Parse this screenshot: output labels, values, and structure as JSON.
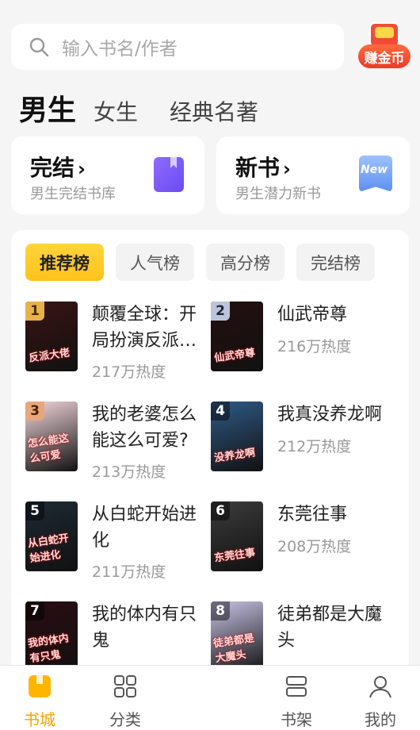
{
  "search": {
    "placeholder": "输入书名/作者"
  },
  "earn_coins": {
    "label": "赚金币"
  },
  "gender_tabs": [
    {
      "label": "男生",
      "active": true
    },
    {
      "label": "女生",
      "active": false
    },
    {
      "label": "经典名著",
      "active": false
    }
  ],
  "cards": [
    {
      "title": "完结",
      "subtitle": "男生完结书库",
      "icon": "book-icon"
    },
    {
      "title": "新书",
      "subtitle": "男生潜力新书",
      "icon": "new-badge-icon",
      "badge": "New"
    }
  ],
  "ranking_tabs": [
    {
      "label": "推荐榜",
      "active": true
    },
    {
      "label": "人气榜",
      "active": false
    },
    {
      "label": "高分榜",
      "active": false
    },
    {
      "label": "完结榜",
      "active": false
    }
  ],
  "books": [
    {
      "rank": "1",
      "title": "颠覆全球：开局扮演反派…",
      "heat": "217万热度",
      "cover_text": "反派大佬",
      "cover_color": "#3a1414"
    },
    {
      "rank": "2",
      "title": "仙武帝尊",
      "heat": "216万热度",
      "cover_text": "仙武帝尊",
      "cover_color": "#241010"
    },
    {
      "rank": "3",
      "title": "我的老婆怎么能这么可爱?",
      "heat": "213万热度",
      "cover_text": "怎么能这么可爱",
      "cover_color": "#f3d7dc"
    },
    {
      "rank": "4",
      "title": "我真没养龙啊",
      "heat": "212万热度",
      "cover_text": "没养龙啊",
      "cover_color": "#2f5a86"
    },
    {
      "rank": "5",
      "title": "从白蛇开始进化",
      "heat": "211万热度",
      "cover_text": "从白蛇开始进化",
      "cover_color": "#1d2a33"
    },
    {
      "rank": "6",
      "title": "东莞往事",
      "heat": "208万热度",
      "cover_text": "东莞往事",
      "cover_color": "#3c3c3c"
    },
    {
      "rank": "7",
      "title": "我的体内有只鬼",
      "heat": "",
      "cover_text": "我的体内有只鬼",
      "cover_color": "#2a0d12"
    },
    {
      "rank": "8",
      "title": "徒弟都是大魔头",
      "heat": "",
      "cover_text": "徒弟都是大魔头",
      "cover_color": "#c9c4e6"
    }
  ],
  "nav": [
    {
      "label": "书城",
      "icon": "bookstore-icon",
      "active": true
    },
    {
      "label": "分类",
      "icon": "category-grid-icon",
      "active": false
    },
    {
      "label": "书架",
      "icon": "bookshelf-icon",
      "active": false
    },
    {
      "label": "我的",
      "icon": "profile-icon",
      "active": false
    }
  ],
  "colors": {
    "accent": "#f6a300",
    "tab_active": "#ffc21a"
  }
}
